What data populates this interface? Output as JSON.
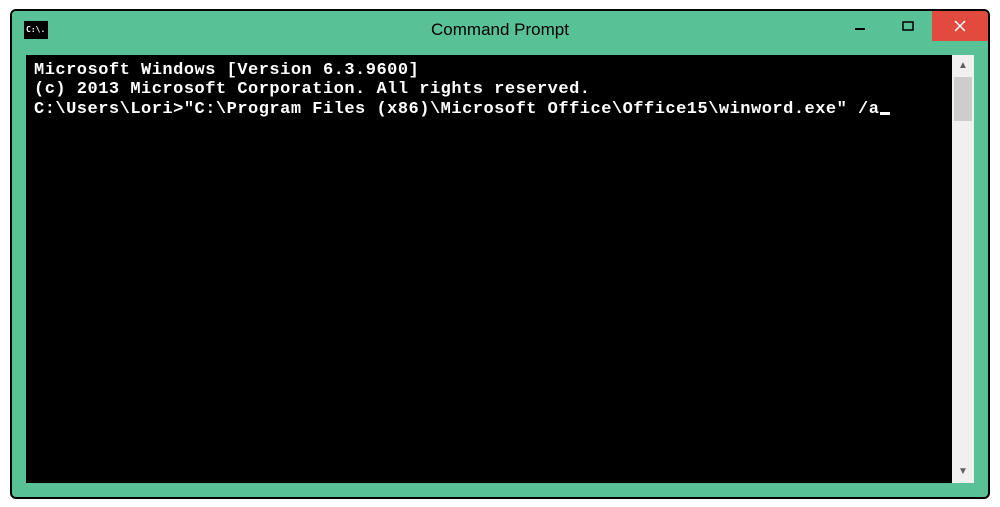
{
  "window": {
    "title": "Command Prompt",
    "icon_label": "C:\\."
  },
  "controls": {
    "minimize": "minimize",
    "maximize": "maximize",
    "close": "close"
  },
  "console": {
    "line1": "Microsoft Windows [Version 6.3.9600]",
    "line2": "(c) 2013 Microsoft Corporation. All rights reserved.",
    "blank": "",
    "prompt": "C:\\Users\\Lori>\"C:\\Program Files (x86)\\Microsoft Office\\Office15\\winword.exe\" /a"
  },
  "scrollbar": {
    "up": "▲",
    "down": "▼"
  }
}
